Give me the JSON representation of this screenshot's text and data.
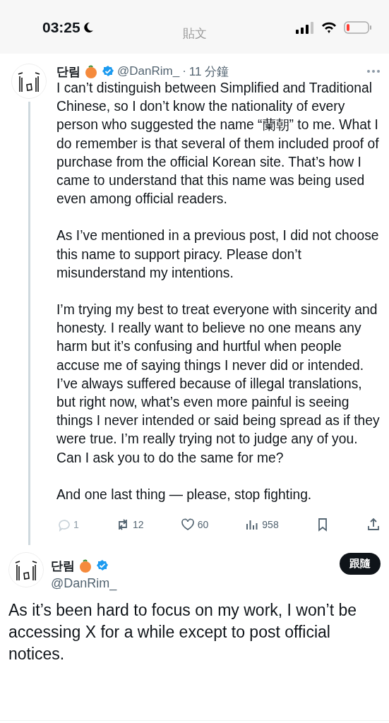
{
  "status_bar": {
    "time": "03:25"
  },
  "header": {
    "title": "貼文"
  },
  "post": {
    "author": {
      "name": "단림",
      "verified": true
    },
    "handle": "@DanRim_",
    "separator": "·",
    "time": "11 分鐘",
    "paragraphs": [
      "I can’t distinguish between Simplified and Traditional Chinese, so I don’t know the nationality of every person who suggested the name “蘭朝” to me. What I do remember is that several of them included proof of purchase from the official Korean site. That’s how I came to understand that this name was being used even among official readers.",
      "As I’ve mentioned in a previous post, I did not choose this name to support piracy. Please don’t misunderstand my intentions.",
      "I’m trying my best to treat everyone with sincerity and honesty. I really want to believe no one means any harm but it’s confusing and hurtful when people accuse me of saying things I never did or intended. I’ve always suffered because of illegal translations, but right now, what’s even more painful is seeing things I never intended or said being spread as if they were true. I’m really trying not to judge any of you. Can I ask you to do the same for me?",
      "And one last thing — please, stop fighting."
    ],
    "actions": [
      {
        "kind": "reply",
        "count": "1",
        "disabled": true
      },
      {
        "kind": "repost",
        "count": "12",
        "disabled": false
      },
      {
        "kind": "like",
        "count": "60",
        "disabled": false
      },
      {
        "kind": "views",
        "count": "958",
        "disabled": false
      },
      {
        "kind": "bookmark",
        "disabled": false
      },
      {
        "kind": "share",
        "disabled": false
      }
    ]
  },
  "next_post": {
    "author": {
      "name": "단림",
      "verified": true
    },
    "handle": "@DanRim_",
    "follow_button": "跟隨",
    "text": "As it’s been hard to focus on my work, I won’t be accessing X for a while except to post official notices."
  }
}
